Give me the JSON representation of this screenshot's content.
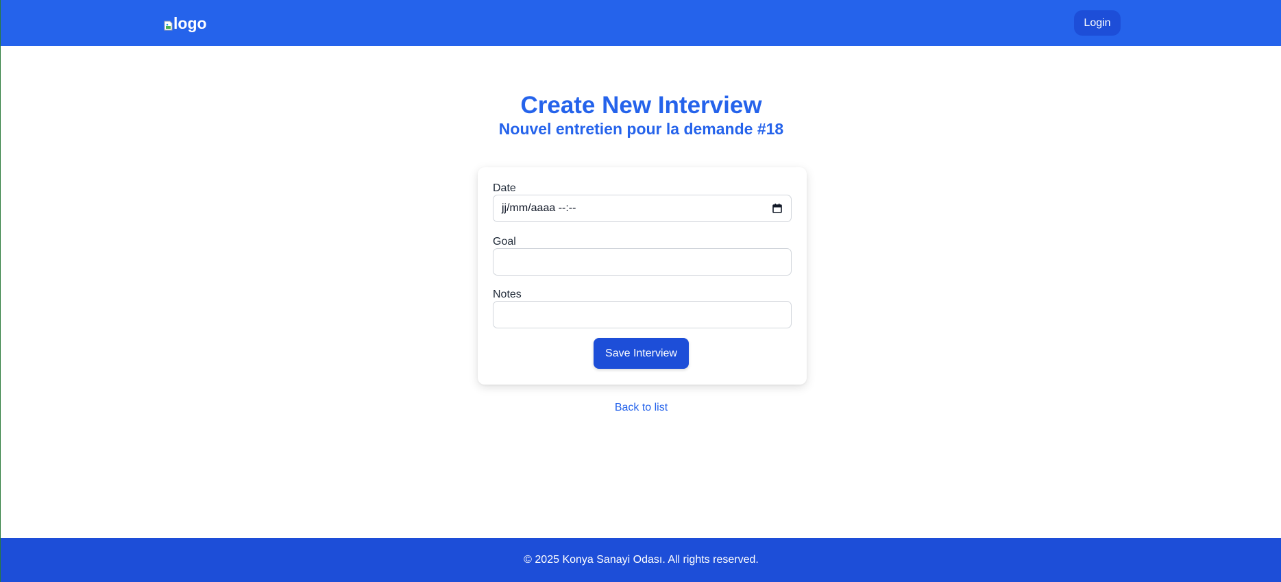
{
  "header": {
    "logo_alt": "logo",
    "login_label": "Login"
  },
  "page": {
    "title": "Create New Interview",
    "subtitle": "Nouvel entretien pour la demande #18"
  },
  "form": {
    "date": {
      "label": "Date",
      "value": "jj/mm/aaaa --:--"
    },
    "goal": {
      "label": "Goal",
      "value": "",
      "placeholder": ""
    },
    "notes": {
      "label": "Notes",
      "value": "",
      "placeholder": ""
    },
    "submit_label": "Save Interview"
  },
  "back_link": "Back to list",
  "footer": {
    "text": "© 2025 Konya Sanayi Odası. All rights reserved."
  },
  "colors": {
    "header_bg": "#2563eb",
    "footer_bg": "#1d4ed8",
    "accent": "#2563eb",
    "button_bg": "#1d4ed8"
  },
  "icons": {
    "logo": "broken-image-icon",
    "date": "calendar-icon"
  }
}
